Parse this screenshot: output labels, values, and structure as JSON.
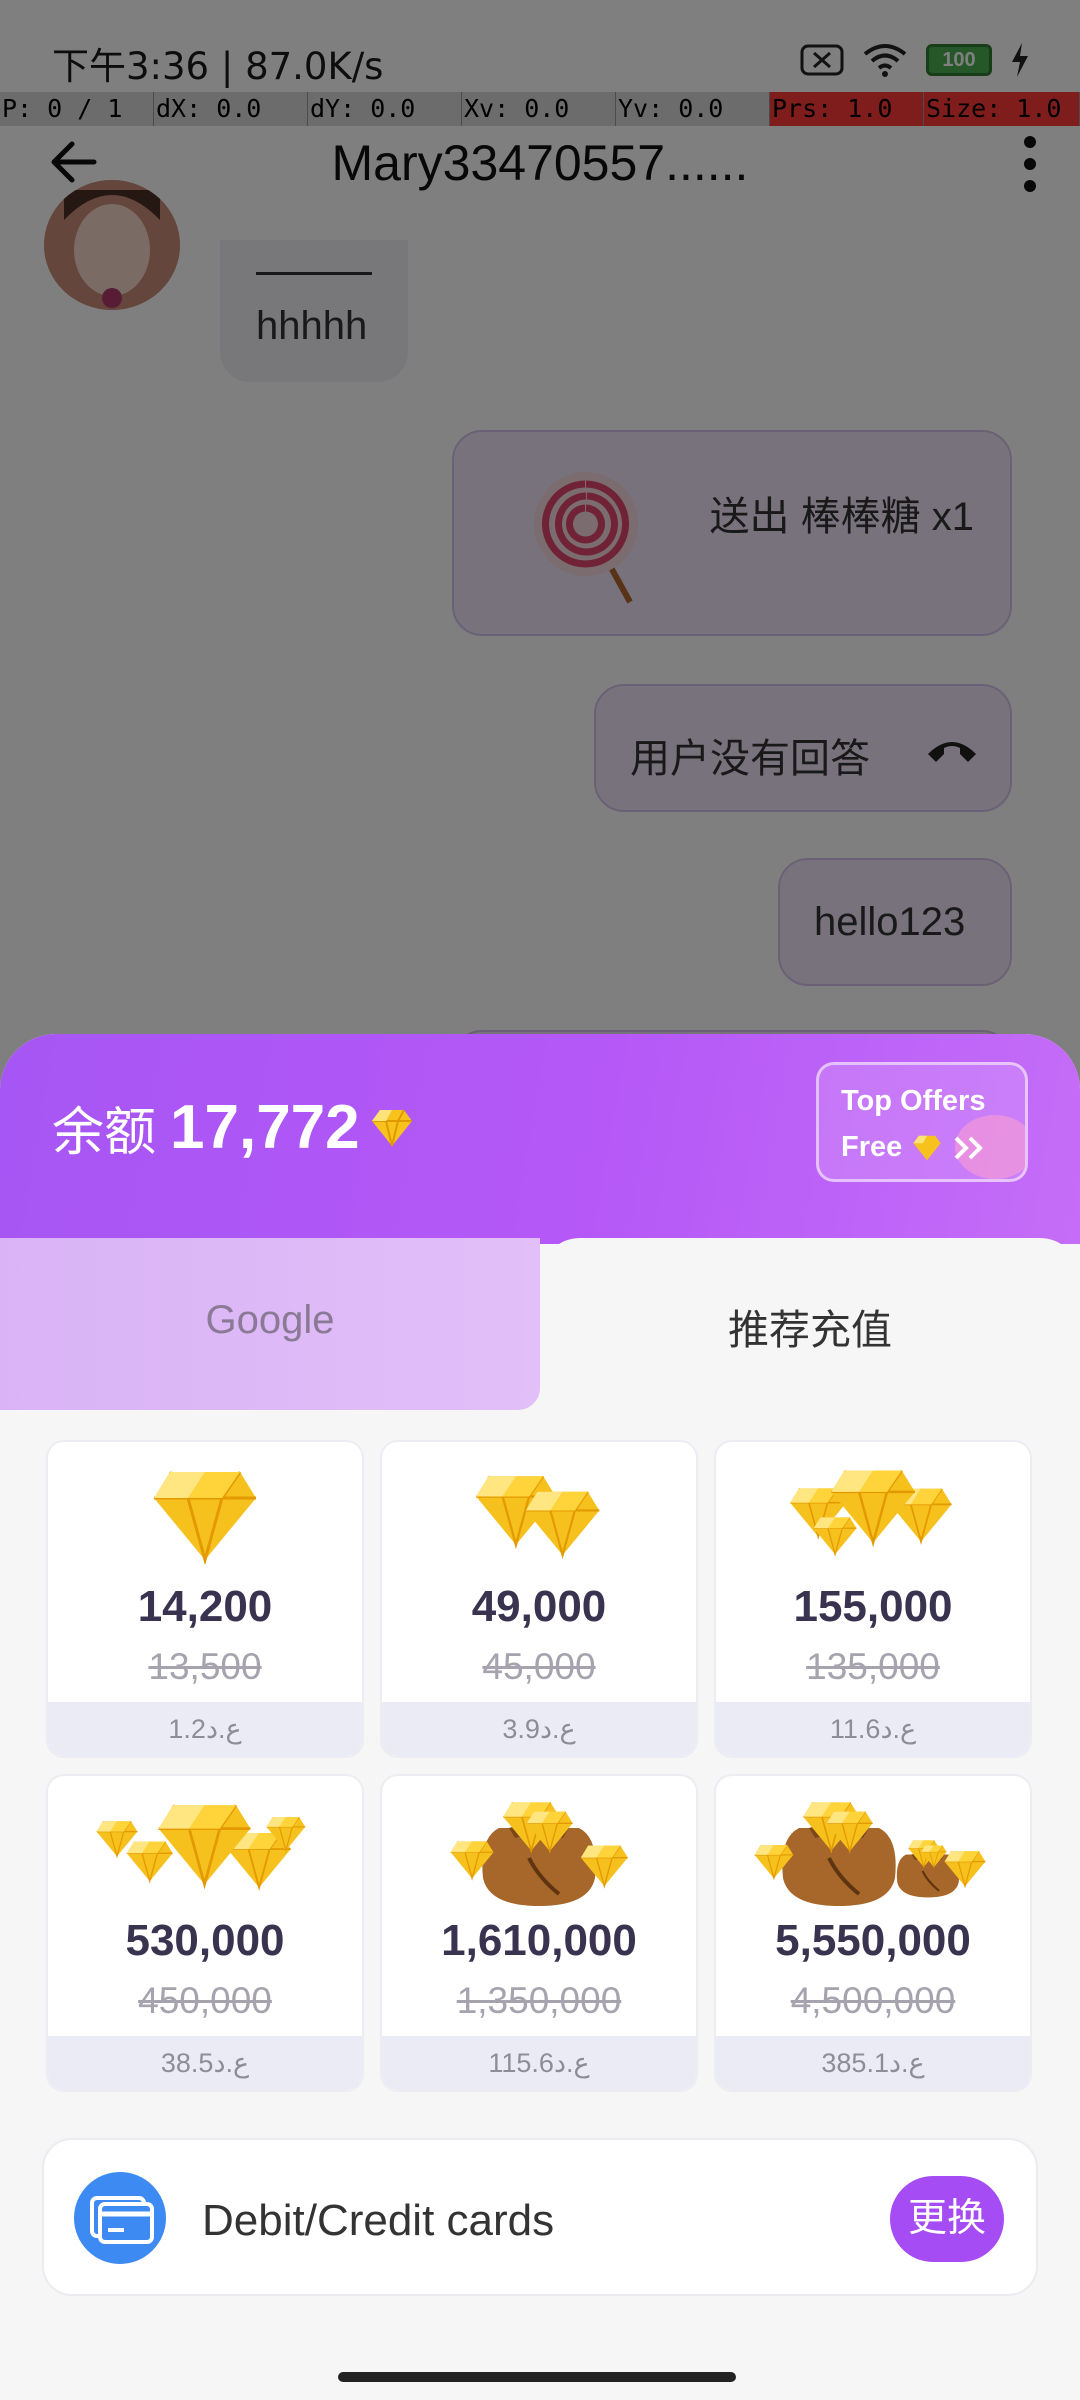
{
  "status_bar": {
    "time": "下午3:36 | 87.0K/s",
    "battery": "100"
  },
  "debug_bar": {
    "p": "P: 0 / 1",
    "dx": "dX: 0.0",
    "dy": "dY: 0.0",
    "xv": "Xv: 0.0",
    "yv": "Yv: 0.0",
    "prs": "Prs: 1.0",
    "size": "Size: 1.0"
  },
  "chat": {
    "title": "Mary33470557......",
    "messages": {
      "incoming_text": "hhhhh",
      "gift_text": "送出 棒棒糖 x1",
      "call_text": "用户没有回答",
      "hello_text": "hello123"
    }
  },
  "sheet": {
    "balance_label": "余额",
    "balance_amount": "17,772",
    "offers": {
      "line1": "Top Offers",
      "line2": "Free"
    },
    "tabs": [
      {
        "label": "Google",
        "active": false
      },
      {
        "label": "推荐充值",
        "active": true
      }
    ],
    "packages": [
      {
        "amount": "14,200",
        "original": "13,500",
        "price": "1.2ع.د",
        "icon": "diamond-single-icon"
      },
      {
        "amount": "49,000",
        "original": "45,000",
        "price": "3.9ع.د",
        "icon": "diamond-pair-icon"
      },
      {
        "amount": "155,000",
        "original": "135,000",
        "price": "11.6ع.د",
        "icon": "diamond-pile-icon"
      },
      {
        "amount": "530,000",
        "original": "450,000",
        "price": "38.5ع.د",
        "icon": "diamond-heap-icon"
      },
      {
        "amount": "1,610,000",
        "original": "1,350,000",
        "price": "115.6ع.د",
        "icon": "diamond-bag-icon"
      },
      {
        "amount": "5,550,000",
        "original": "4,500,000",
        "price": "385.1ع.د",
        "icon": "diamond-bags-icon"
      }
    ],
    "payment": {
      "method": "Debit/Credit cards",
      "change_label": "更换",
      "icon": "credit-card-icon"
    }
  },
  "colors": {
    "header_purple": "#b558f7",
    "accent_purple": "#a64cf5",
    "tab_google": "#ddb8f7",
    "price_strip": "#ebebf5",
    "card_icon_blue": "#3d8bf2",
    "diamond_gold": "#f5c518"
  }
}
